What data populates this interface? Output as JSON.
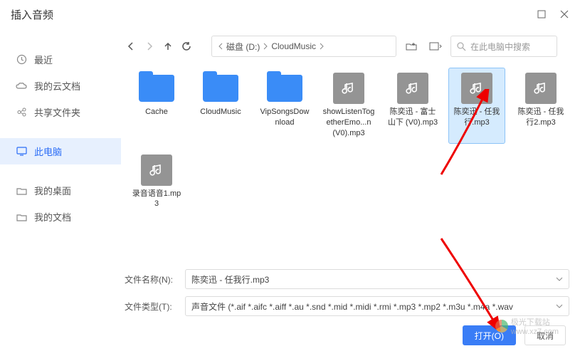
{
  "title": "插入音频",
  "sidebar": {
    "recent": "最近",
    "cloud": "我的云文档",
    "shared": "共享文件夹",
    "this_pc": "此电脑",
    "desktop": "我的桌面",
    "documents": "我的文档"
  },
  "path": {
    "disk": "磁盘 (D:)",
    "folder": "CloudMusic"
  },
  "search": {
    "placeholder": "在此电脑中搜索"
  },
  "files": [
    {
      "name": "Cache",
      "type": "folder"
    },
    {
      "name": "CloudMusic",
      "type": "folder"
    },
    {
      "name": "VipSongsDownload",
      "type": "folder"
    },
    {
      "name": "showListenTogetherEmo...n (V0).mp3",
      "type": "audio"
    },
    {
      "name": "陈奕迅 - 富士山下 (V0).mp3",
      "type": "audio"
    },
    {
      "name": "陈奕迅 - 任我行.mp3",
      "type": "audio",
      "selected": true
    },
    {
      "name": "陈奕迅 - 任我行2.mp3",
      "type": "audio"
    },
    {
      "name": "录音语音1.mp3",
      "type": "audio"
    }
  ],
  "form": {
    "filename_label": "文件名称(N):",
    "filename_value": "陈奕迅 - 任我行.mp3",
    "filetype_label": "文件类型(T):",
    "filetype_value": "声音文件 (*.aif *.aifc *.aiff *.au *.snd *.mid *.midi *.rmi *.mp3 *.mp2 *.m3u *.m4a *.wav"
  },
  "buttons": {
    "open": "打开(O)",
    "cancel": "取消"
  },
  "watermark": {
    "site": "极光下载站",
    "url": "www.xz7.com"
  }
}
